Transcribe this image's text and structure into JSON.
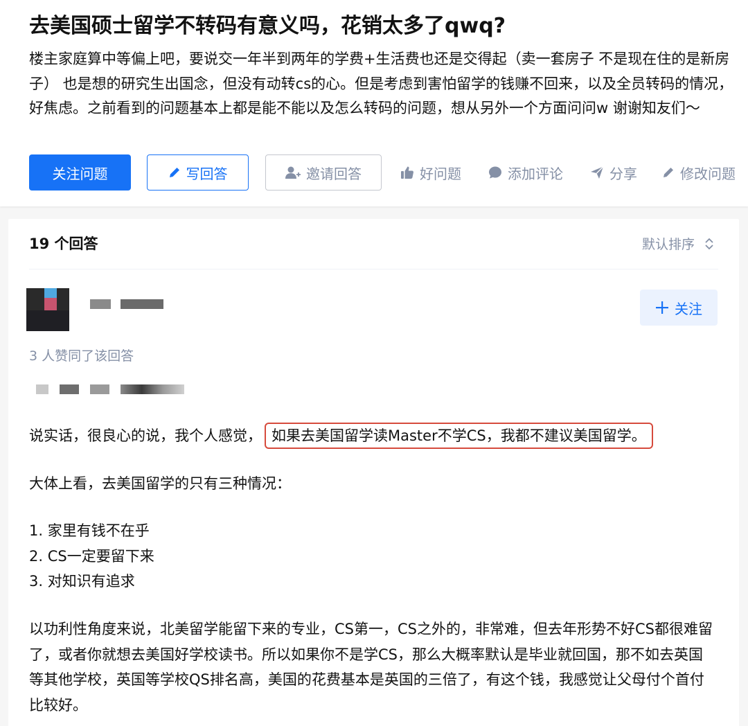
{
  "question": {
    "title": "去美国硕士留学不转码有意义吗，花销太多了qwq?",
    "detail": "楼主家庭算中等偏上吧，要说交一年半到两年的学费+生活费也还是交得起（卖一套房子 不是现在住的是新房子） 也是想的研究生出国念，但没有动转cs的心。但是考虑到害怕留学的钱赚不回来，以及全员转码的情况，好焦虑。之前看到的问题基本上都是能不能以及怎么转码的问题，想从另外一个方面问问w 谢谢知友们～"
  },
  "actions": {
    "follow_question": "关注问题",
    "write_answer": "写回答",
    "invite_answer": "邀请回答",
    "good_question": "好问题",
    "add_comment": "添加评论",
    "share": "分享",
    "edit_question": "修改问题"
  },
  "answers": {
    "count_label": "19 个回答",
    "sort_label": "默认排序"
  },
  "answer": {
    "follow_label": "关注",
    "voters_text": "3 人赞同了该回答",
    "p1_before": "说实话，很良心的说，我个人感觉，",
    "p1_highlight": "如果去美国留学读Master不学CS，我都不建议美国留学。",
    "p2": "大体上看，去美国留学的只有三种情况：",
    "list": [
      "1. 家里有钱不在乎",
      "2. CS一定要留下来",
      "3. 对知识有追求"
    ],
    "p3": "以功利性角度来说，北美留学能留下来的专业，CS第一，CS之外的，非常难，但去年形势不好CS都很难留了，或者你就想去美国好学校读书。所以如果你不是学CS，那么大概率默认是毕业就回国，那不如去英国等其他学校，英国等学校QS排名高，美国的花费基本是英国的三倍了，有这个钱，我感觉让父母付个首付比较好。"
  },
  "colors": {
    "primary": "#1772f6",
    "muted": "#8590a6",
    "highlight_border": "#d64a3c"
  },
  "icons": [
    "pencil-icon",
    "invite-user-icon",
    "thumbs-up-icon",
    "comment-icon",
    "share-icon",
    "edit-icon",
    "sort-chevron-icon",
    "plus-icon"
  ]
}
